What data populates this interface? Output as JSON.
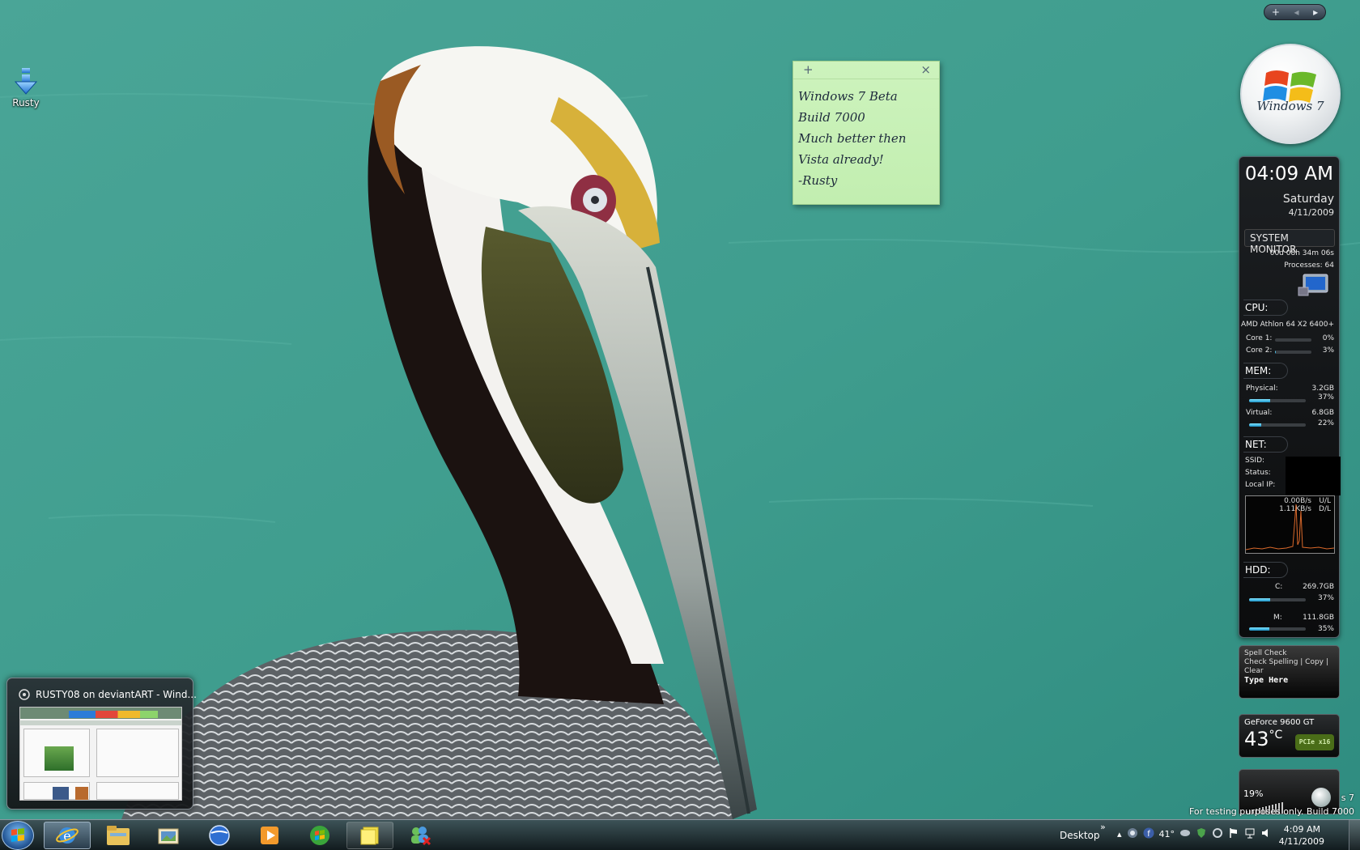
{
  "desktop": {
    "icon_label": "Rusty"
  },
  "sticky_note": {
    "plus": "+",
    "close": "×",
    "lines": [
      "Windows 7 Beta",
      "Build 7000",
      "Much better then",
      "Vista already!",
      "-Rusty"
    ]
  },
  "gadget_controls": {
    "add": "+",
    "prev": "◂",
    "next": "▸"
  },
  "win7_gadget": {
    "text": "Windows 7"
  },
  "sysmon": {
    "time": "04:09 AM",
    "day": "Saturday",
    "date": "4/11/2009",
    "title": "SYSTEM MONITOR",
    "uptime": "00d 08h 34m 06s",
    "processes": "Processes: 64",
    "cpu": {
      "label": "CPU:",
      "model": "AMD Athlon 64 X2 6400+",
      "cores": [
        {
          "name": "Core 1:",
          "value": "0%",
          "level": 0
        },
        {
          "name": "Core 2:",
          "value": "3%",
          "level": 3
        }
      ]
    },
    "mem": {
      "label": "MEM:",
      "physical": {
        "name": "Physical:",
        "size": "3.2GB",
        "pct": "37%",
        "level": 37
      },
      "virtual": {
        "name": "Virtual:",
        "size": "6.8GB",
        "pct": "22%",
        "level": 22
      }
    },
    "net": {
      "label": "NET:",
      "ssid": "SSID:",
      "status": "Status:",
      "local_ip": "Local IP:",
      "up_speed": "0.00B/s",
      "up_label": "U/L",
      "down_speed": "1.11KB/s",
      "down_label": "D/L"
    },
    "hdd": {
      "label": "HDD:",
      "drives": [
        {
          "name": "C:",
          "size": "269.7GB",
          "pct": "37%",
          "level": 37
        },
        {
          "name": "M:",
          "size": "111.8GB",
          "pct": "35%",
          "level": 35
        }
      ]
    }
  },
  "spell_check": {
    "title": "Spell Check",
    "actions": "Check Spelling | Copy | Clear",
    "placeholder": "Type Here"
  },
  "gpu": {
    "name": "GeForce 9600 GT",
    "temp": "43",
    "unit": "°C",
    "bus": "PCIe x16"
  },
  "volume": {
    "pct": "19%",
    "level": 19
  },
  "watermark": {
    "line1": "s 7",
    "line2": "For testing purposes only. Build 7000"
  },
  "thumbnail": {
    "title": "RUSTY08 on deviantART - Wind..."
  },
  "taskbar": {
    "toolbar_label": "Desktop",
    "chevron": "»",
    "temperature": "41°",
    "time": "4:09 AM",
    "date": "4/11/2009",
    "colors": {
      "accent": "#1f4f8d"
    }
  }
}
